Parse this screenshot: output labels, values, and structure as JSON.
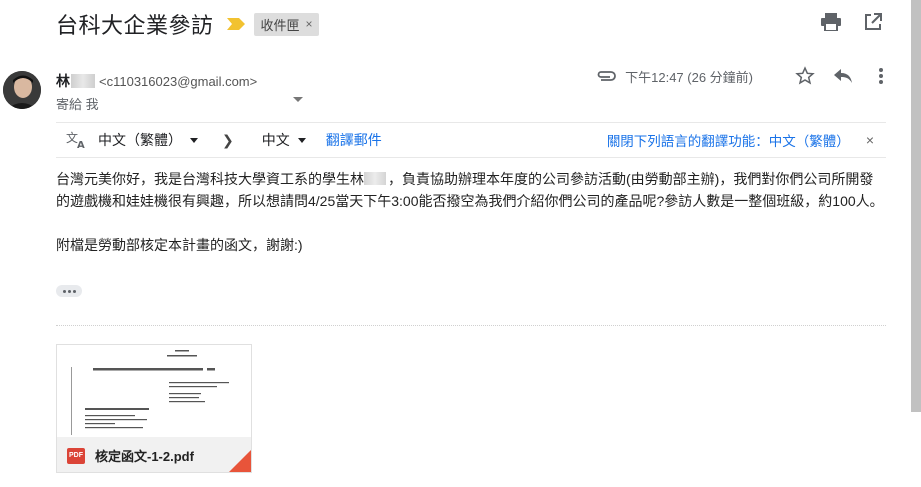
{
  "subject": "台科大企業參訪",
  "label": {
    "name": "收件匣",
    "remove": "×"
  },
  "sender": {
    "name": "林",
    "email": "<c110316023@gmail.com>",
    "to": "寄給 我"
  },
  "meta": {
    "timestamp": "下午12:47 (26 分鐘前)"
  },
  "translate": {
    "source_lang": "中文（繁體）",
    "target_lang": "中文",
    "translate_link": "翻譯郵件",
    "turn_off": "關閉下列語言的翻譯功能：中文（繁體）",
    "close": "×"
  },
  "body": {
    "para1_a": "台灣元美你好，我是台灣科技大學資工系的學生林",
    "para1_b": "，負責協助辦理本年度的公司參訪活動(由勞動部主辦)，我們對你們公司所開發的遊戲機和娃娃機很有興趣，所以想請問4/25當天下午3:00能否撥空為我們介紹你們公司的產品呢?參訪人數是一整個班級，約100人。",
    "para2": "附檔是勞動部核定本計畫的函文，謝謝:)"
  },
  "attachment": {
    "filename": "核定函文-1-2.pdf",
    "type_badge": "PDF"
  },
  "colors": {
    "link": "#1a73e8",
    "important_marker": "#f2c230",
    "pdf_red": "#db4437"
  }
}
